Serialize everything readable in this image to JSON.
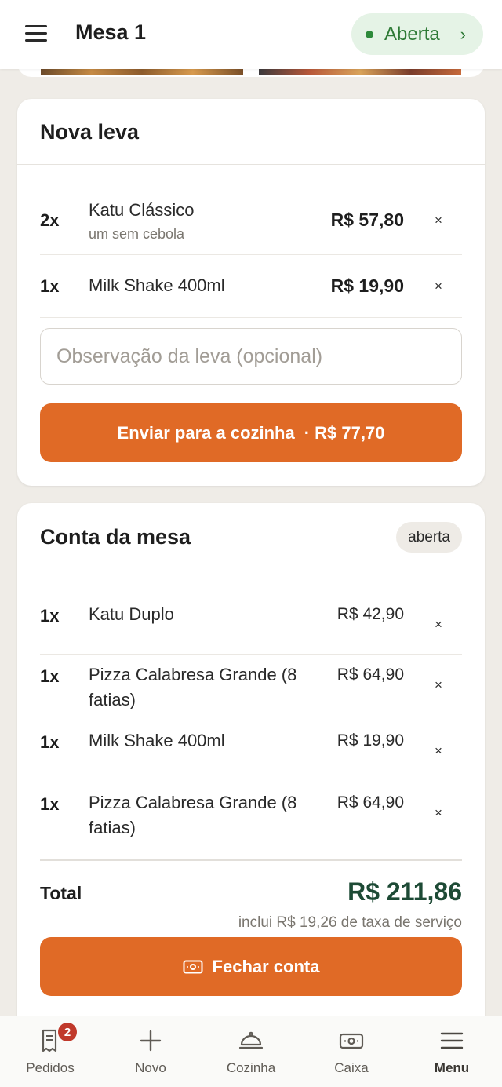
{
  "header": {
    "title": "Mesa 1",
    "status_label": "Aberta",
    "status_color": "#2e8a3b"
  },
  "nova_leva": {
    "title": "Nova leva",
    "items": [
      {
        "qty": "2x",
        "name": "Katu Clássico",
        "note": "um sem cebola",
        "price": "R$ 57,80",
        "remove": "×"
      },
      {
        "qty": "1x",
        "name": "Milk Shake 400ml",
        "note": "",
        "price": "R$ 19,90",
        "remove": "×"
      }
    ],
    "observation_placeholder": "Observação da leva (opcional)",
    "send_label": "Enviar para a cozinha",
    "send_total": "· R$ 77,70"
  },
  "conta": {
    "title": "Conta da mesa",
    "badge": "aberta",
    "items": [
      {
        "qty": "1x",
        "name": "Katu Duplo",
        "price": "R$ 42,90",
        "remove": "×"
      },
      {
        "qty": "1x",
        "name": "Pizza Calabresa Grande (8 fatias)",
        "price": "R$ 64,90",
        "remove": "×"
      },
      {
        "qty": "1x",
        "name": "Milk Shake 400ml",
        "price": "R$ 19,90",
        "remove": "×"
      },
      {
        "qty": "1x",
        "name": "Pizza Calabresa Grande (8 fatias)",
        "price": "R$ 64,90",
        "remove": "×"
      }
    ],
    "total_label": "Total",
    "total_value": "R$ 211,86",
    "service_note": "inclui R$ 19,26 de taxa de serviço",
    "close_label": "Fechar conta"
  },
  "bottom_nav": {
    "items": [
      {
        "label": "Pedidos",
        "icon": "receipt-icon",
        "badge": "2"
      },
      {
        "label": "Novo",
        "icon": "plus-icon"
      },
      {
        "label": "Cozinha",
        "icon": "cloche-icon"
      },
      {
        "label": "Caixa",
        "icon": "cash-icon"
      },
      {
        "label": "Menu",
        "icon": "hamburger-icon",
        "active": true
      }
    ]
  },
  "colors": {
    "accent": "#e06a26",
    "total": "#1d4a35",
    "background": "#efece7"
  }
}
